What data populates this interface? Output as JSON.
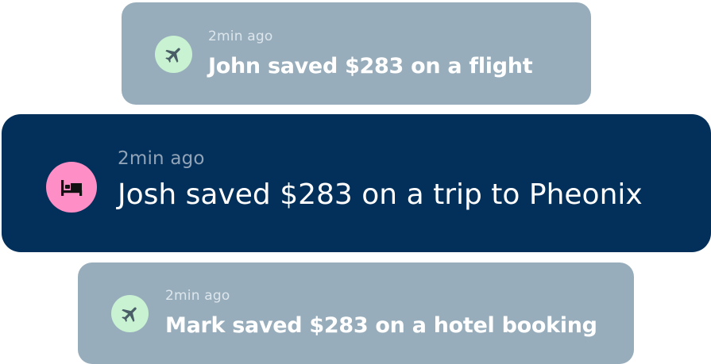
{
  "notifications": [
    {
      "time": "2min ago",
      "message": "John saved $283 on a flight",
      "icon": "airplane-icon",
      "icon_bg": "#c9f2d3",
      "card_bg": "#98adbb"
    },
    {
      "time": "2min ago",
      "message": "Josh saved $283 on a trip to Pheonix",
      "icon": "bed-icon",
      "icon_bg": "#fd8fc6",
      "card_bg": "#03305a"
    },
    {
      "time": "2min ago",
      "message": "Mark saved $283 on a hotel booking",
      "icon": "airplane-icon",
      "icon_bg": "#c9f2d3",
      "card_bg": "#98adbb"
    }
  ]
}
